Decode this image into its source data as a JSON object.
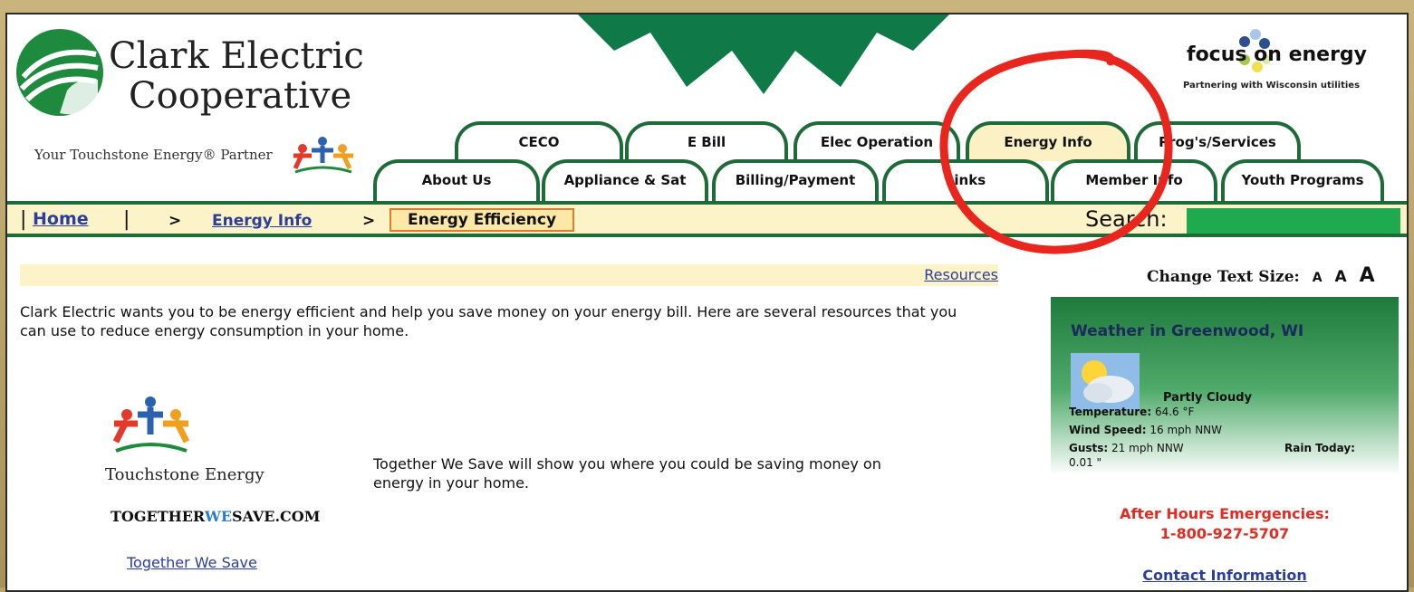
{
  "brand": {
    "name_line1": "Clark Electric",
    "name_line2": "Cooperative",
    "tagline": "Your Touchstone Energy® Partner",
    "partner_title": "focus on energy",
    "partner_sub": "Partnering with Wisconsin utilities"
  },
  "tabs_row1": [
    "CECO",
    "E Bill",
    "Elec Operation",
    "Energy Info",
    "Prog's/Services"
  ],
  "tabs_row2": [
    "About Us",
    "Appliance & Sat",
    "Billing/Payment",
    "Links",
    "Member Info",
    "Youth Programs"
  ],
  "breadcrumb": {
    "home": "Home",
    "level2": "Energy Info",
    "current": "Energy Efficiency",
    "sep": ">"
  },
  "search": {
    "label": "Search:",
    "value": ""
  },
  "resources_link": "Resources",
  "intro": "Clark Electric wants you to be energy efficient and help you save money on your energy bill. Here are several resources that you can use to reduce energy consumption in your home.",
  "touchstone": {
    "brand": "Touchstone Energy",
    "url_pre": "TOGETHER",
    "url_we": "WE",
    "url_post": "SAVE.COM",
    "link": "Together We Save",
    "description": "Together We Save will show you where you could be saving money on energy in your home."
  },
  "text_size": {
    "label": "Change Text Size:",
    "small": "A",
    "medium": "A",
    "large": "A"
  },
  "weather": {
    "title": "Weather in Greenwood, WI",
    "condition": "Partly Cloudy",
    "temp_label": "Temperature:",
    "temp_value": "64.6 °F",
    "wind_label": "Wind Speed:",
    "wind_value": "16 mph NNW",
    "gusts_label": "Gusts:",
    "gusts_value": "21 mph NNW",
    "rain_label": "Rain Today:",
    "rain_value": "0.01 \""
  },
  "emergency": {
    "label": "After Hours Emergencies:",
    "phone": "1-800-927-5707"
  },
  "contact_link": "Contact Information",
  "colors": {
    "green": "#1e6b3a",
    "cream": "#fcf3c8",
    "link": "#2b3e9c",
    "alert": "#e32b22"
  }
}
